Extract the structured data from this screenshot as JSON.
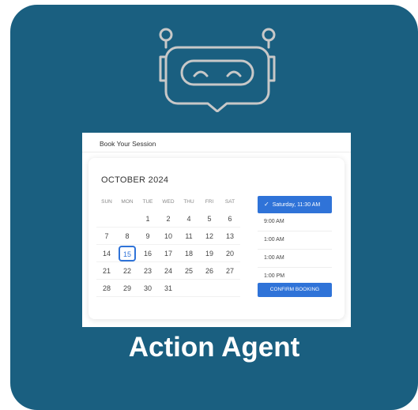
{
  "card": {
    "background": "#1a5f80"
  },
  "icon": {
    "name": "robot-icon",
    "color": "#c8c8c8"
  },
  "booking": {
    "title": "Book Your Session",
    "month": "OCTOBER 2024",
    "weekdays": [
      "SUN",
      "MON",
      "TUE",
      "WED",
      "THU",
      "FRI",
      "SAT"
    ],
    "weeks": [
      [
        "",
        "",
        "1",
        "2",
        "4",
        "5",
        "6"
      ],
      [
        "7",
        "8",
        "9",
        "10",
        "11",
        "12",
        "13"
      ],
      [
        "14",
        "15",
        "16",
        "17",
        "18",
        "19",
        "20"
      ],
      [
        "21",
        "22",
        "23",
        "24",
        "25",
        "26",
        "27"
      ],
      [
        "28",
        "29",
        "30",
        "31",
        "",
        "",
        ""
      ]
    ],
    "selected_day": "15",
    "slots": [
      "Saturday, 11:30 AM",
      "9:00 AM",
      "1:00 AM",
      "1:00 AM",
      "1:00 PM"
    ],
    "active_slot": "Saturday, 11:30 AM",
    "confirm_label": "CONFIRM BOOKING",
    "accent": "#2f73d8"
  },
  "label": "Action Agent"
}
